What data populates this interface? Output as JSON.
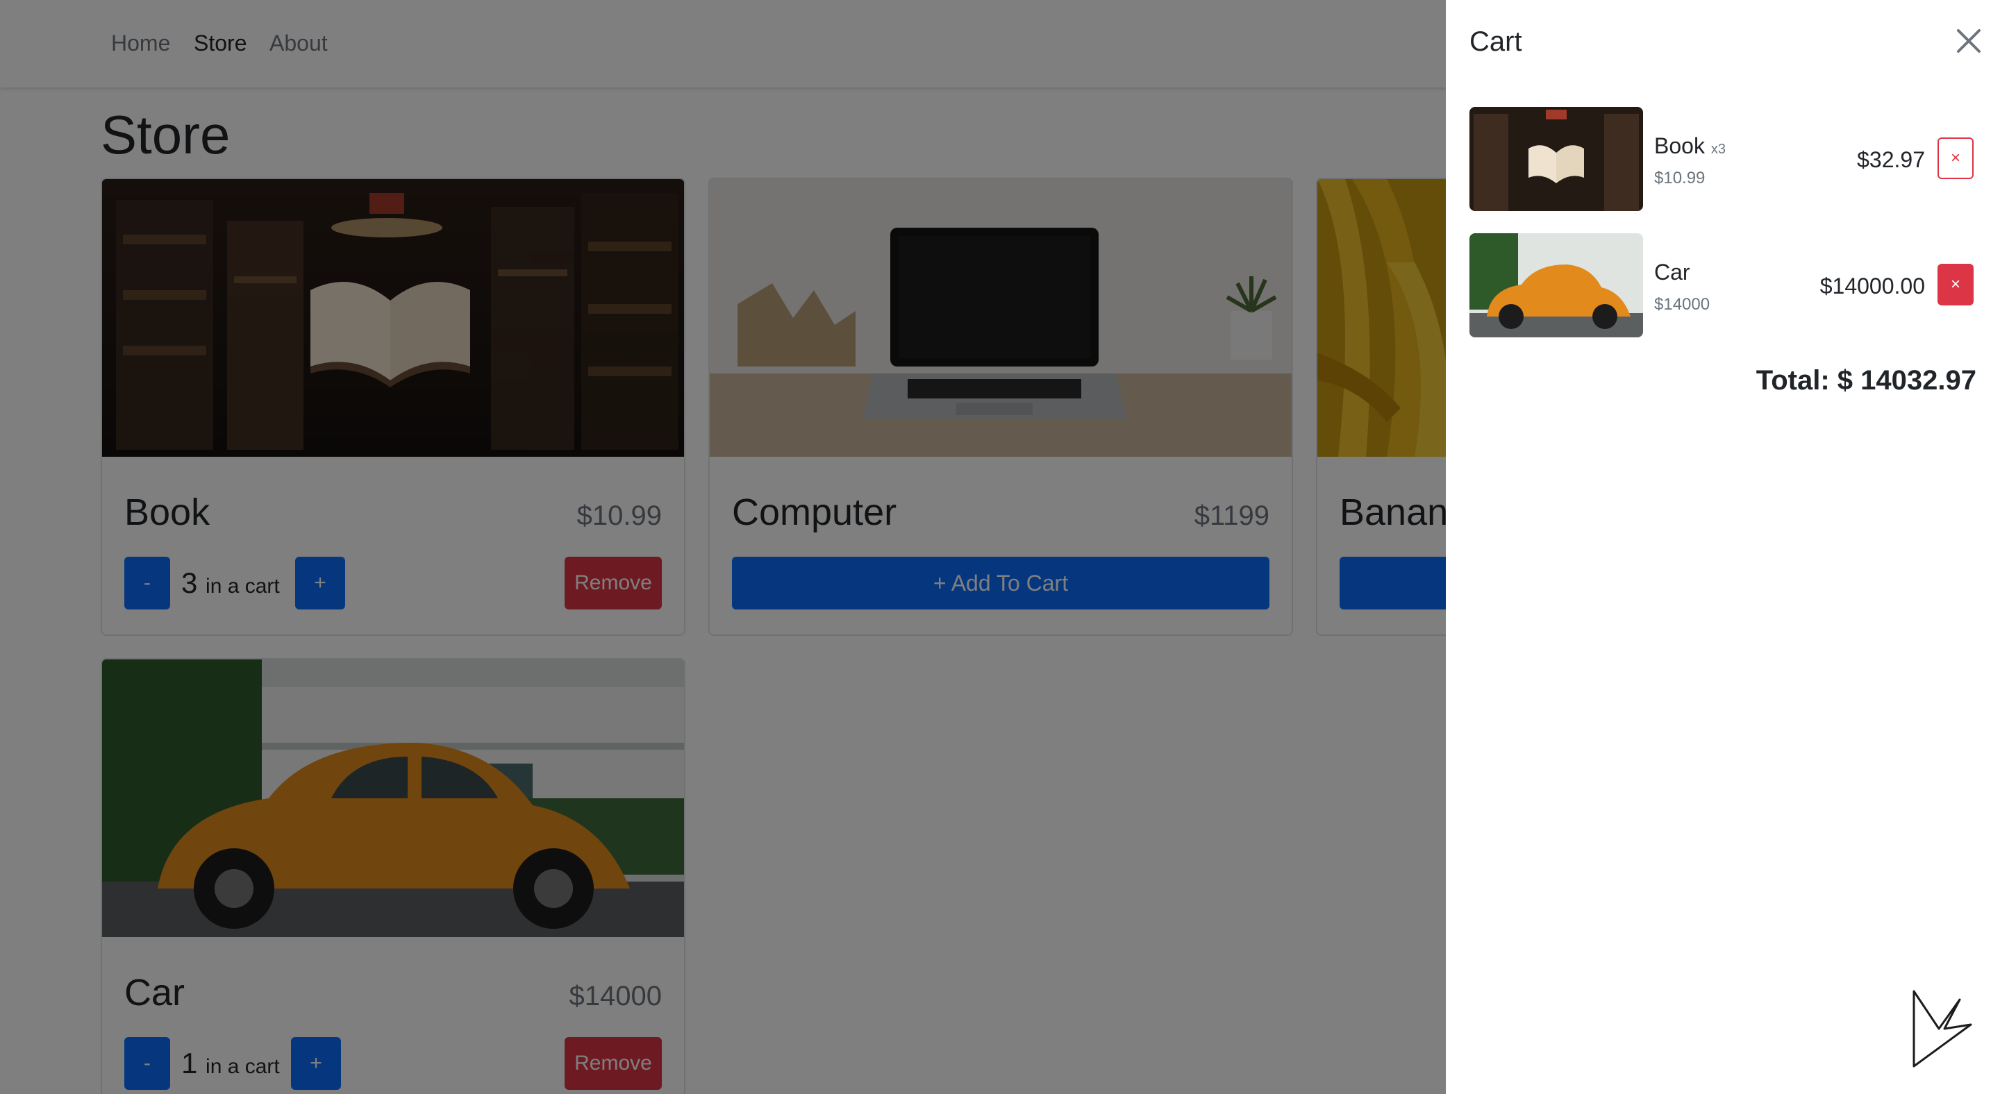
{
  "nav": {
    "home": "Home",
    "store": "Store",
    "about": "About"
  },
  "page_title": "Store",
  "products": [
    {
      "name": "Book",
      "price": "$10.99",
      "quantity": "3",
      "in_cart_label": "in a cart",
      "remove_label": "Remove",
      "minus_label": "-",
      "plus_label": "+"
    },
    {
      "name": "Computer",
      "price": "$1199",
      "add_label": "+ Add To Cart"
    },
    {
      "name": "Banan"
    },
    {
      "name": "Car",
      "price": "$14000",
      "quantity": "1",
      "in_cart_label": "in a cart",
      "remove_label": "Remove",
      "minus_label": "-",
      "plus_label": "+"
    }
  ],
  "cart": {
    "title": "Cart",
    "items": [
      {
        "name": "Book",
        "qty": "x3",
        "unit_price": "$10.99",
        "line_total": "$32.97",
        "remove_label": "×"
      },
      {
        "name": "Car",
        "unit_price": "$14000",
        "line_total": "$14000.00",
        "remove_label": "×"
      }
    ],
    "total": "Total: $ 14032.97"
  },
  "icons": {
    "close": "close-icon",
    "logo": "logo-icon"
  },
  "colors": {
    "primary": "#0d6efd",
    "danger": "#dc3545",
    "backdrop": "rgba(0,0,0,0.5)"
  }
}
